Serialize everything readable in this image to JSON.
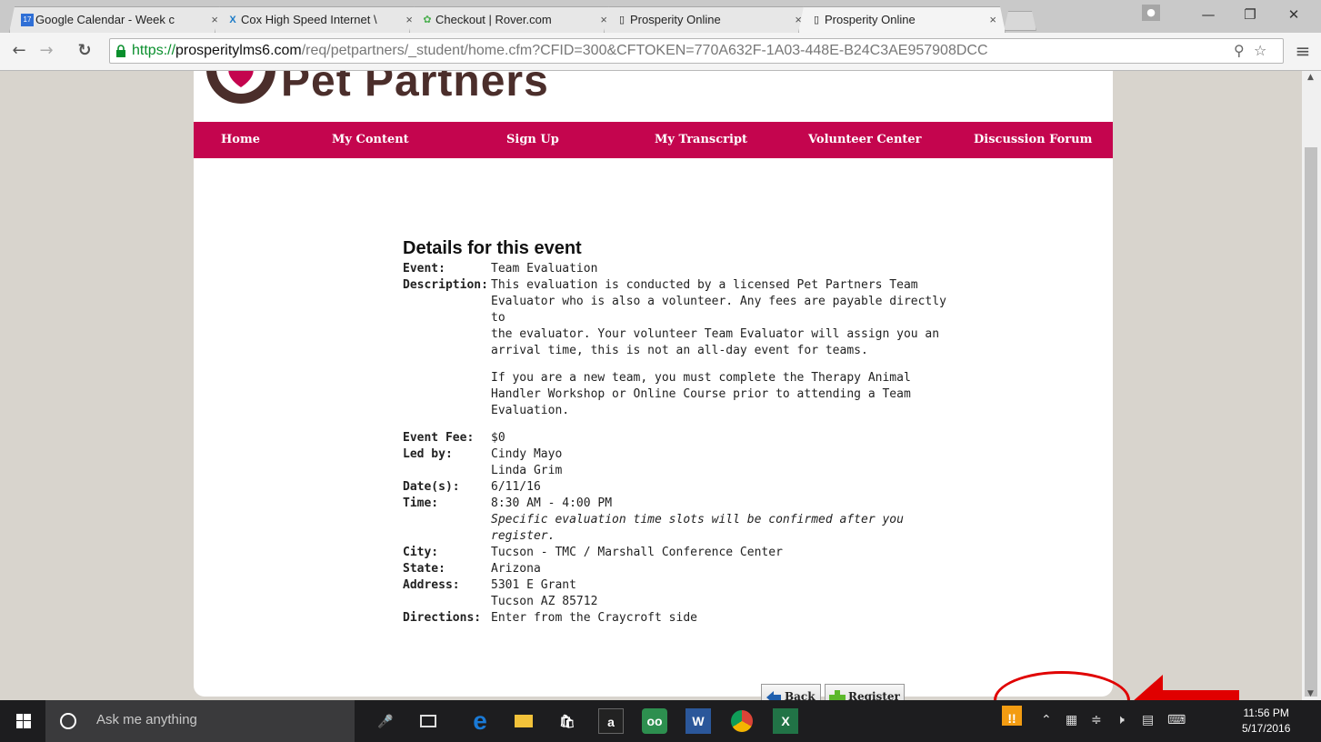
{
  "browser": {
    "tabs": [
      {
        "label": "Google Calendar - Week c",
        "icon": "calendar-icon",
        "active": false
      },
      {
        "label": "Cox High Speed Internet \\",
        "icon": "cox-icon",
        "active": false
      },
      {
        "label": "Checkout | Rover.com",
        "icon": "rover-paw-icon",
        "active": false
      },
      {
        "label": "Prosperity Online",
        "icon": "page-icon",
        "active": false
      },
      {
        "label": "Prosperity Online",
        "icon": "page-icon",
        "active": true
      }
    ],
    "tab_close": "×",
    "url": {
      "scheme": "https://",
      "host": "prosperitylms6.com",
      "path": "/req/petpartners/_student/home.cfm?CFID=300&CFTOKEN=770A632F-1A03-448E-B24C3AE957908DCC"
    }
  },
  "site": {
    "logo_text": "Pet Partners",
    "nav": [
      "Home",
      "My Content",
      "Sign Up",
      "My Transcript",
      "Volunteer Center",
      "Discussion Forum"
    ],
    "colors": {
      "nav_bg": "#c4054e",
      "logo_brown": "#4b2e2b",
      "annotation_red": "#e00000"
    }
  },
  "event": {
    "heading": "Details for this event",
    "labels": {
      "event": "Event:",
      "description": "Description:",
      "fee": "Event Fee:",
      "led_by": "Led by:",
      "dates": "Date(s):",
      "time": "Time:",
      "city": "City:",
      "state": "State:",
      "address": "Address:",
      "directions": "Directions:"
    },
    "event_name": "Team Evaluation",
    "description_lines": [
      "This evaluation is conducted by a licensed Pet Partners Team",
      "Evaluator who is also a volunteer. Any fees are payable directly to",
      "the evaluator. Your volunteer Team Evaluator will assign you an",
      "arrival time, this is not an all-day event for teams."
    ],
    "description2_lines": [
      "If you are a new team, you must complete the Therapy Animal",
      "Handler Workshop or Online Course prior to attending a Team",
      "Evaluation."
    ],
    "fee": "$0",
    "leaders": [
      "Cindy Mayo",
      "Linda Grim"
    ],
    "dates": "6/11/16",
    "time": "8:30 AM - 4:00 PM",
    "time_note": "Specific evaluation time slots will be confirmed after you register.",
    "city": "Tucson - TMC / Marshall Conference Center",
    "state": "Arizona",
    "address_lines": [
      "5301 E Grant",
      "Tucson AZ 85712"
    ],
    "directions": "Enter from the Craycroft side"
  },
  "buttons": {
    "back": "Back",
    "register": "Register"
  },
  "taskbar": {
    "search_placeholder": "Ask me anything",
    "clock_time": "11:56 PM",
    "clock_date": "5/17/2016"
  }
}
